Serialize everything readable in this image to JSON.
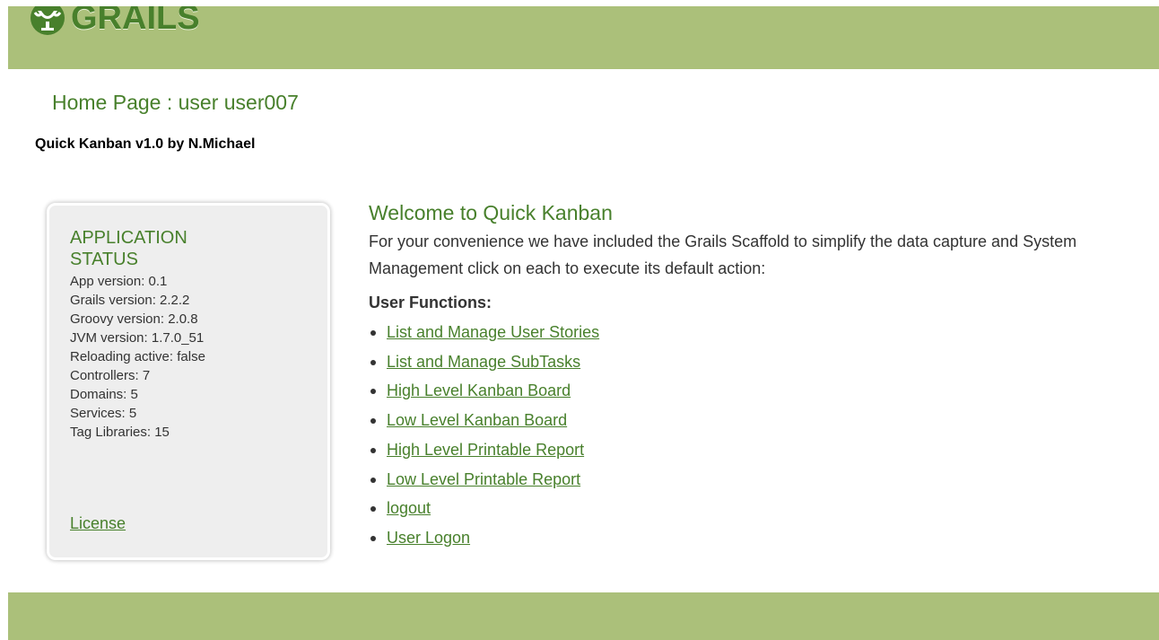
{
  "header": {
    "logo_text": "GRAILS",
    "brand_color": "#48802c",
    "bar_color": "#abc07a"
  },
  "page_title": "Home Page : user user007",
  "byline": "Quick Kanban v1.0 by N.Michael",
  "status": {
    "heading": "APPLICATION STATUS",
    "items": [
      "App version: 0.1",
      "Grails version: 2.2.2",
      "Groovy version: 2.0.8",
      "JVM version: 1.7.0_51",
      "Reloading active: false",
      "Controllers: 7",
      "Domains: 5",
      "Services: 5",
      "Tag Libraries: 15"
    ],
    "license_label": "License"
  },
  "main": {
    "welcome": "Welcome to Quick Kanban",
    "intro": "For your convenience we have included the Grails Scaffold to simplify the data capture and System Management click on each to execute its default action:",
    "functions_heading": "User Functions:",
    "links": [
      "List and Manage User Stories",
      "List and Manage SubTasks",
      "High Level Kanban Board",
      "Low Level Kanban Board",
      "High Level Printable Report",
      "Low Level Printable Report",
      "logout",
      "User Logon"
    ]
  }
}
